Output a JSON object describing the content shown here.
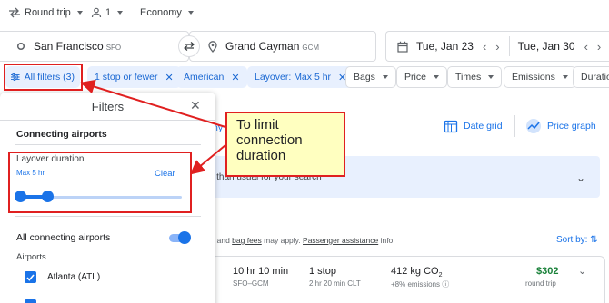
{
  "top_bar": {
    "trip_type": "Round trip",
    "passengers": "1",
    "cabin_class": "Economy"
  },
  "search": {
    "origin": "San Francisco",
    "origin_code": "SFO",
    "destination": "Grand Cayman",
    "destination_code": "GCM",
    "depart_date": "Tue, Jan 23",
    "return_date": "Tue, Jan 30"
  },
  "filter_chips": {
    "all_filters": "All filters (3)",
    "stops": "1 stop or fewer",
    "airline": "American",
    "layover": "Layover: Max 5 hr",
    "bags": "Bags",
    "price": "Price",
    "times": "Times",
    "emissions": "Emissions",
    "duration": "Duratio"
  },
  "background": {
    "any_text": "ny",
    "date_grid": "Date grid",
    "price_graph": "Price graph",
    "banner_text": "r than usual for your search",
    "bag_fees_prefix": "s and",
    "bag_fees_link": "bag fees",
    "bag_fees_mid": "may apply.",
    "assistance_link": "Passenger assistance",
    "bag_fees_suffix": "info.",
    "sort_by": "Sort by:"
  },
  "result": {
    "duration": "10 hr 10 min",
    "route": "SFO–GCM",
    "stops": "1 stop",
    "layover": "2 hr 20 min CLT",
    "emissions_value": "412 kg CO",
    "emissions_sub": "2",
    "emissions_delta": "+8% emissions",
    "price": "$302",
    "price_note": "round trip"
  },
  "filters_panel": {
    "title": "Filters",
    "connecting_airports_heading": "Connecting airports",
    "layover_label": "Layover duration",
    "layover_value": "Max 5 hr",
    "clear_label": "Clear",
    "layover_fraction": 0.17,
    "all_connecting_label": "All connecting airports",
    "all_connecting_on": true,
    "airports_label": "Airports",
    "airports": [
      {
        "name": "Atlanta (ATL)",
        "checked": true
      }
    ]
  },
  "annotation": {
    "callout_text": "To limit connection duration"
  },
  "colors": {
    "accent": "#1a73e8",
    "annotation_red": "#e02020",
    "callout_bg": "#ffffc0",
    "price_green": "#188038"
  }
}
